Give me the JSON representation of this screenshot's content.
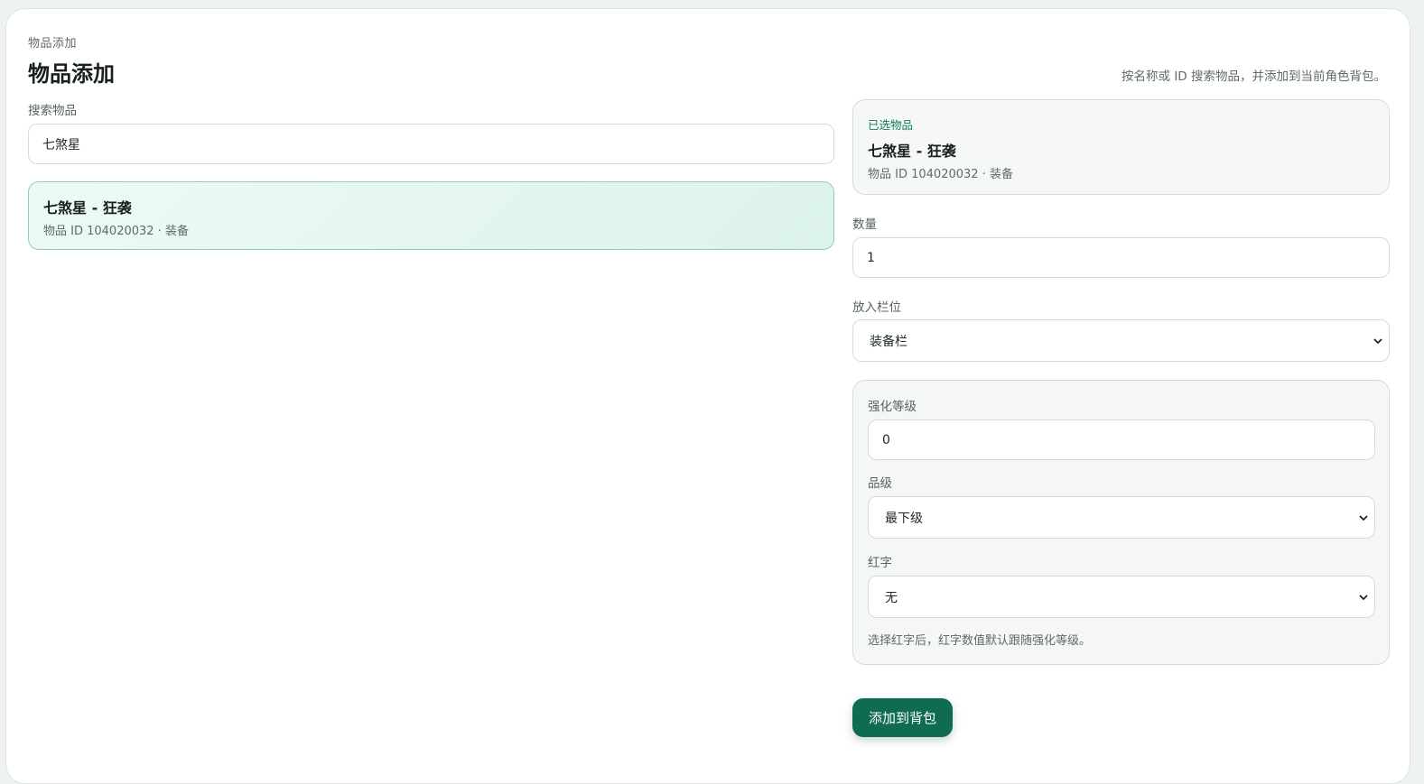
{
  "header": {
    "breadcrumb": "物品添加",
    "title": "物品添加",
    "hint": "按名称或 ID 搜索物品，并添加到当前角色背包。"
  },
  "search": {
    "label": "搜索物品",
    "value": "七煞星"
  },
  "results": [
    {
      "name": "七煞星 - 狂袭",
      "meta": "物品 ID 104020032 · 装备"
    }
  ],
  "selected": {
    "tag": "已选物品",
    "name": "七煞星 - 狂袭",
    "meta": "物品 ID 104020032 · 装备"
  },
  "quantity": {
    "label": "数量",
    "value": "1"
  },
  "slot": {
    "label": "放入栏位",
    "value": "装备栏"
  },
  "enhance": {
    "level_label": "强化等级",
    "level_value": "0",
    "grade_label": "品级",
    "grade_value": "最下级",
    "red_label": "红字",
    "red_value": "无",
    "note": "选择红字后，红字数值默认跟随强化等级。"
  },
  "actions": {
    "submit_label": "添加到背包"
  },
  "colors": {
    "accent": "#0f6b52",
    "accent_text": "#117a5b",
    "result_bg": "#e3f6ee",
    "result_border": "#8fd0b5"
  },
  "icons": {
    "select_arrow": "chevron-down-icon"
  }
}
